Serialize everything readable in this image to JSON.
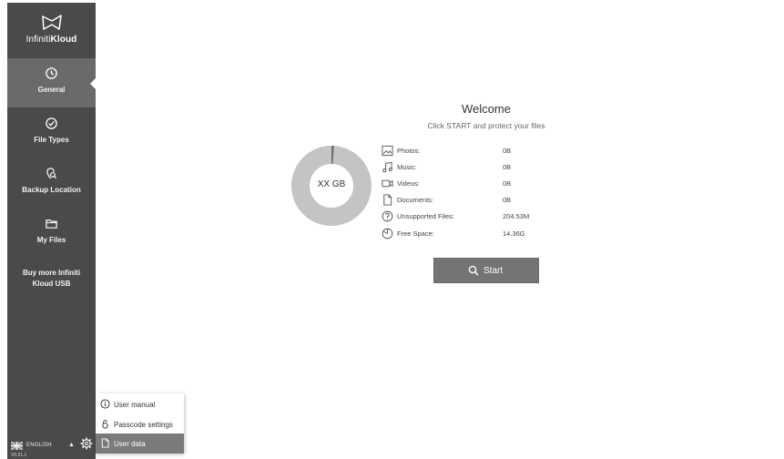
{
  "app": {
    "brand_prefix": "Infiniti",
    "brand_suffix": "Kloud"
  },
  "sidebar": {
    "items": [
      {
        "label": "General",
        "icon": "clock-icon"
      },
      {
        "label": "File Types",
        "icon": "check-circle-icon"
      },
      {
        "label": "Backup Location",
        "icon": "location-search-icon"
      },
      {
        "label": "My Files",
        "icon": "folder-icon"
      }
    ],
    "buy_label": "Buy more Infiniti Kloud USB",
    "language": "ENGLISH",
    "version": "V0.21.1"
  },
  "popup": {
    "items": [
      {
        "label": "User manual",
        "icon": "info-icon"
      },
      {
        "label": "Passcode settings",
        "icon": "lock-icon"
      },
      {
        "label": "User data",
        "icon": "document-icon"
      }
    ]
  },
  "main": {
    "title": "Welcome",
    "subtitle": "Click START and protect your files",
    "storage_label": "XX GB",
    "used_fraction": 0.01,
    "rows": [
      {
        "label": "Photos:",
        "value": "0B",
        "icon": "image-icon"
      },
      {
        "label": "Music:",
        "value": "0B",
        "icon": "music-icon"
      },
      {
        "label": "Videos:",
        "value": "0B",
        "icon": "video-icon"
      },
      {
        "label": "Documents:",
        "value": "0B",
        "icon": "document-icon"
      },
      {
        "label": "Unsupported Files:",
        "value": "204.53M",
        "icon": "question-icon"
      },
      {
        "label": "Free Space:",
        "value": "14.36G",
        "icon": "pie-icon"
      }
    ],
    "start_label": "Start"
  },
  "colors": {
    "sidebar_bg": "#4a4a4a",
    "sidebar_active": "#6a6a6a",
    "donut_ring": "#c4c4c4",
    "button_bg": "#747474"
  }
}
